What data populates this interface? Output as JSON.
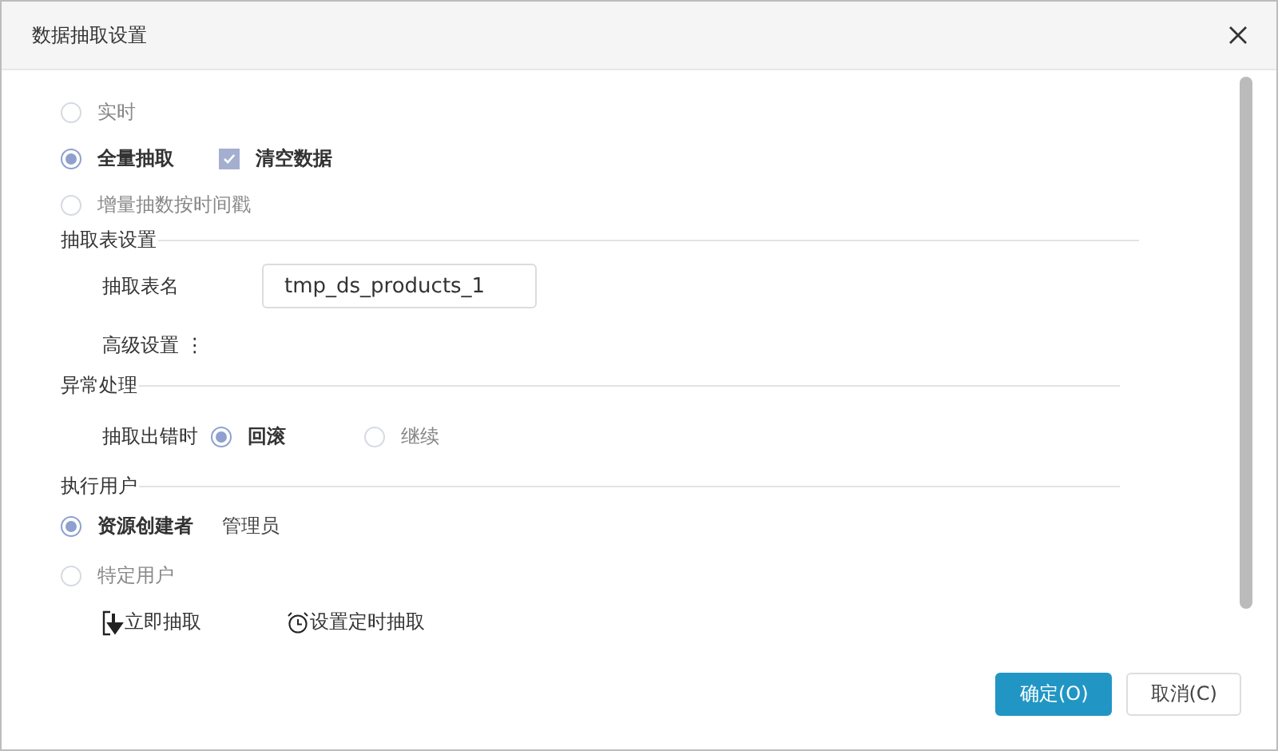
{
  "window": {
    "title": "数据抽取设置"
  },
  "modes": [
    {
      "label": "实时",
      "selected": false
    },
    {
      "label": "全量抽取",
      "selected": true
    },
    {
      "label": "增量抽数按时间戳",
      "selected": false
    }
  ],
  "clear_data": {
    "label": "清空数据",
    "checked": true
  },
  "table_settings": {
    "heading": "抽取表设置",
    "name_label": "抽取表名",
    "name_value": "tmp_ds_products_1",
    "advanced": "高级设置",
    "advanced_icon": "⋮"
  },
  "error_handling": {
    "heading": "异常处理",
    "label": "抽取出错时",
    "options": [
      {
        "label": "回滚",
        "selected": true
      },
      {
        "label": "继续",
        "selected": false
      }
    ]
  },
  "run_user": {
    "heading": "执行用户",
    "options": [
      {
        "label": "资源创建者",
        "selected": true,
        "detail": "管理员"
      },
      {
        "label": "特定用户",
        "selected": false
      }
    ]
  },
  "actions": [
    {
      "label": "立即抽取",
      "kind": "extract"
    },
    {
      "label": "设置定时抽取",
      "kind": "schedule"
    }
  ],
  "buttons": [
    {
      "label": "确定(O)",
      "kind": "primary"
    },
    {
      "label": "取消(C)",
      "kind": "default"
    }
  ]
}
